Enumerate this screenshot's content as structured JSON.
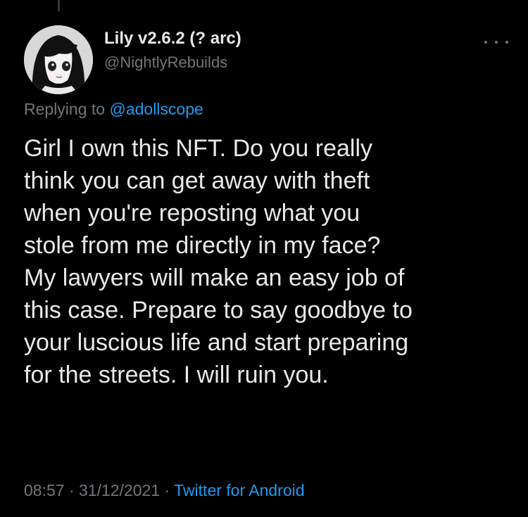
{
  "tweet": {
    "display_name": "Lily v2.6.2 (? arc)",
    "handle": "@NightlyRebuilds",
    "replying_prefix": "Replying to ",
    "replying_to": "@adollscope",
    "text": "Girl I own this NFT. Do you really\nthink you can get away with theft\nwhen you're reposting what you\nstole from me directly in my face?\nMy lawyers will make an easy job of\nthis case. Prepare to say goodbye to\nyour luscious life and start preparing\nfor the streets. I will ruin you.",
    "time": "08:57",
    "separator": " · ",
    "date": "31/12/2021",
    "source": "Twitter for Android"
  },
  "icons": {
    "more": "more-horizontal-icon",
    "avatar": "profile-avatar"
  },
  "colors": {
    "background": "#000000",
    "text_primary": "#e7e9ea",
    "text_secondary": "#71767b",
    "accent": "#1d9bf0"
  }
}
